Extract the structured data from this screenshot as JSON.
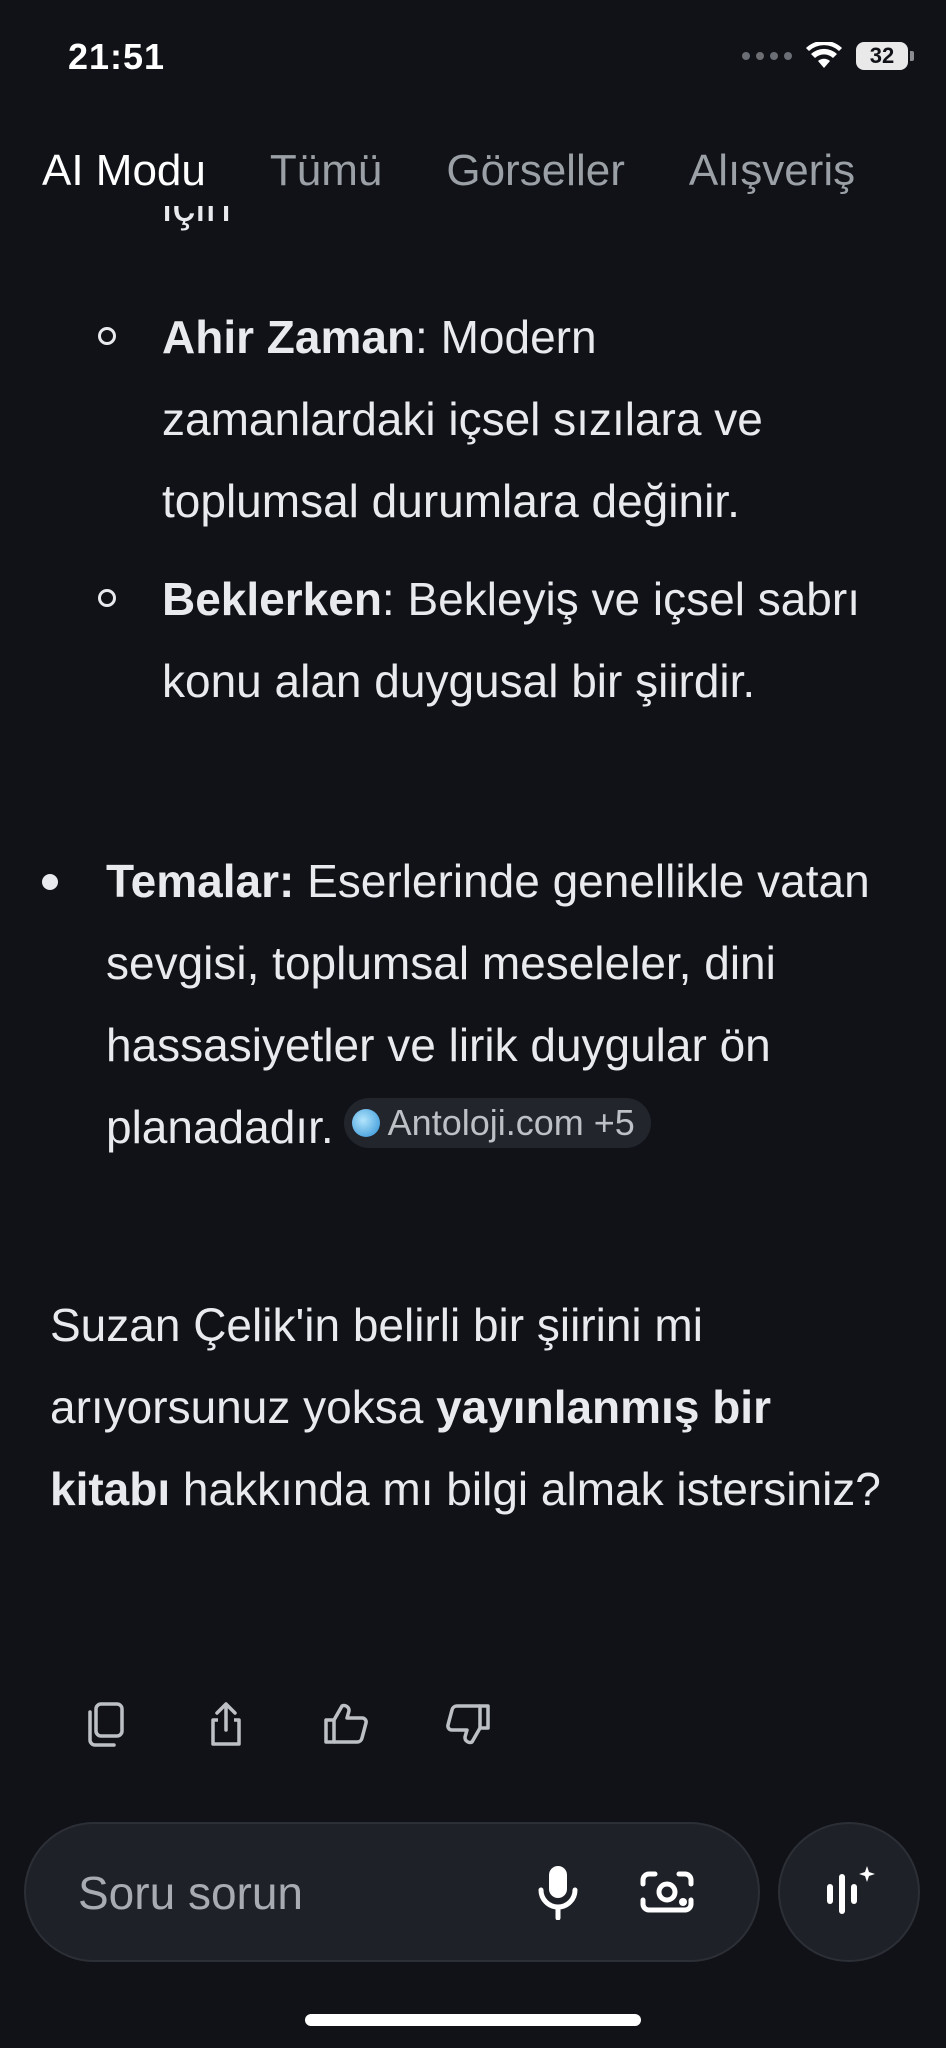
{
  "status_bar": {
    "time": "21:51",
    "battery": "32"
  },
  "tabs": [
    {
      "label": "AI Modu",
      "active": true
    },
    {
      "label": "Tümü"
    },
    {
      "label": "Görseller"
    },
    {
      "label": "Alışveriş"
    }
  ],
  "content": {
    "clipped_top_text": "için",
    "sub_items": [
      {
        "title": "Ahir Zaman",
        "text": ": Modern zamanlardaki içsel sızılara ve toplumsal durumlara değinir."
      },
      {
        "title": "Beklerken",
        "text": ": Bekleyiş ve içsel sabrı konu alan duygusal bir şiirdir."
      }
    ],
    "main_item": {
      "title": "Temalar:",
      "text": " Eserlerinde genellikle vatan sevgisi, toplumsal meseleler, dini hassasiyetler ve lirik duygular ön planadadır.",
      "source_chip": "Antoloji.com +5"
    },
    "follow_up": {
      "part1": "Suzan Çelik'in belirli bir şiirini mi arıyorsunuz yoksa ",
      "bold": "yayınlanmış bir kitabı",
      "part2": " hakkında mı bilgi almak istersiniz?"
    }
  },
  "feedback_icons": [
    "copy-icon",
    "share-icon",
    "thumbs-up-icon",
    "thumbs-down-icon"
  ],
  "search": {
    "placeholder": "Soru sorun"
  },
  "colors": {
    "background": "#101218",
    "text": "#e8eaed",
    "muted": "#9aa0a6",
    "surface": "#1e2128"
  }
}
